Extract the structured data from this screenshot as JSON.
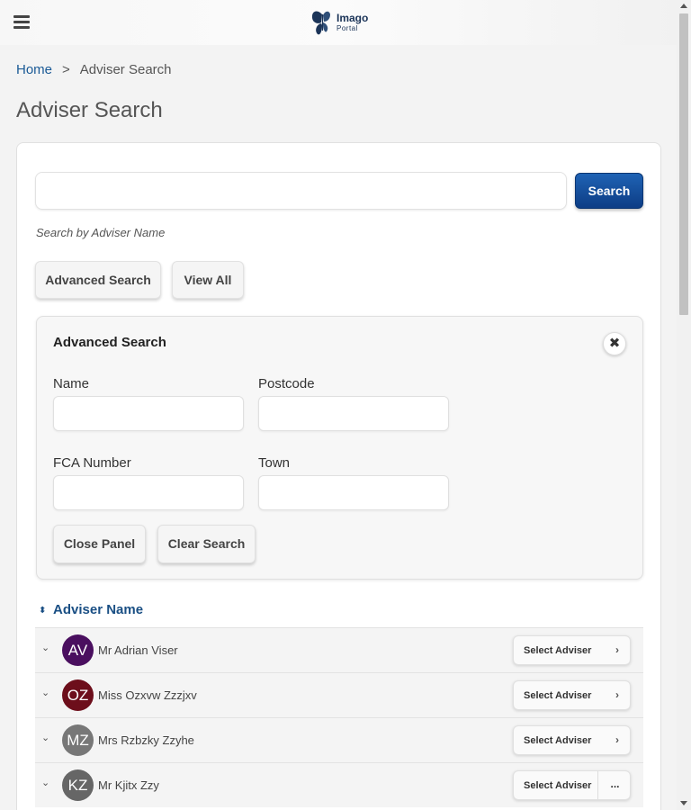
{
  "header": {
    "brand_line1": "Imago",
    "brand_line2": "Portal"
  },
  "breadcrumb": {
    "home": "Home",
    "separator": ">",
    "current": "Adviser Search"
  },
  "page": {
    "title": "Adviser Search"
  },
  "search": {
    "value": "",
    "placeholder": "",
    "button": "Search",
    "hint": "Search by Adviser Name",
    "advanced_button": "Advanced Search",
    "view_all_button": "View All"
  },
  "advanced_panel": {
    "title": "Advanced Search",
    "close_icon": "close-icon",
    "fields": {
      "name_label": "Name",
      "postcode_label": "Postcode",
      "fca_label": "FCA Number",
      "town_label": "Town"
    },
    "close_panel_button": "Close Panel",
    "clear_search_button": "Clear Search"
  },
  "results": {
    "sort_header": "Adviser Name",
    "rows": [
      {
        "initials": "AV",
        "name": "Mr Adrian Viser",
        "action": "Select Adviser",
        "trailing": "›",
        "avatar_color": "#4a0f5f"
      },
      {
        "initials": "OZ",
        "name": "Miss Ozxvw Zzzjxv",
        "action": "Select Adviser",
        "trailing": "›",
        "avatar_color": "#6d0e1b"
      },
      {
        "initials": "MZ",
        "name": "Mrs Rzbzky Zzyhe",
        "action": "Select Adviser",
        "trailing": "›",
        "avatar_color": "#777777"
      },
      {
        "initials": "KZ",
        "name": "Mr Kjitx Zzy",
        "action": "Select Adviser",
        "trailing": "...",
        "avatar_color": "#666666"
      }
    ]
  },
  "colors": {
    "primary": "#0d3d85",
    "link": "#1a5a96"
  }
}
